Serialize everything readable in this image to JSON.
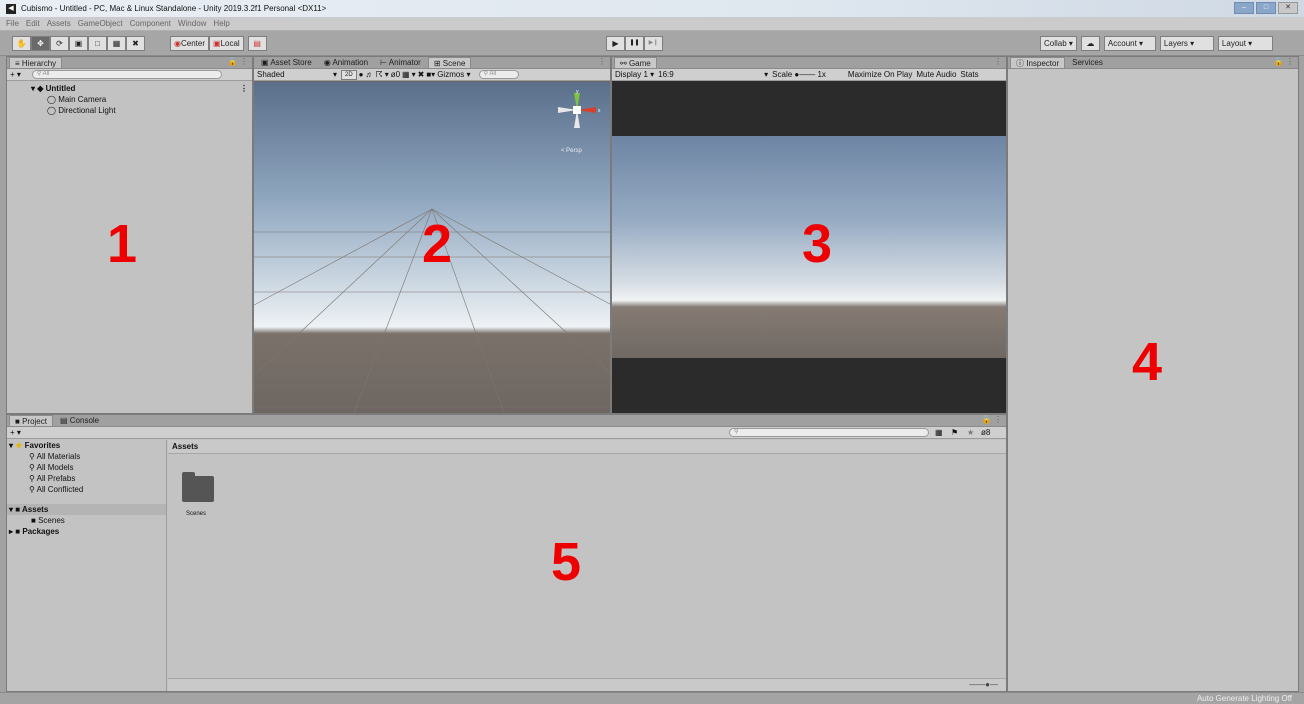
{
  "window": {
    "title": "Cubismo - Untitled - PC, Mac & Linux Standalone - Unity 2019.3.2f1 Personal <DX11>",
    "controls": [
      "–",
      "□",
      "✕"
    ]
  },
  "menu": [
    "File",
    "Edit",
    "Assets",
    "GameObject",
    "Component",
    "Window",
    "Help"
  ],
  "toolbar": {
    "tools": [
      "hand-icon",
      "move-icon",
      "rotate-icon",
      "scale-icon",
      "rect-icon",
      "transform-icon",
      "custom-tool-icon"
    ],
    "pivot_label": "Center",
    "space_label": "Local",
    "play_controls": [
      "▶",
      "❚❚",
      "▶❙"
    ],
    "collab_label": "Collab ▾",
    "account_label": "Account",
    "layers_label": "Layers",
    "layout_label": "Layout"
  },
  "hierarchy": {
    "tab": "Hierarchy",
    "add": "+ ▾",
    "search_placeholder": "All",
    "scene": "Untitled",
    "items": [
      "Main Camera",
      "Directional Light"
    ]
  },
  "scene_panel": {
    "tabs": [
      "Asset Store",
      "Animation",
      "Animator",
      "Scene"
    ],
    "shading": "Shaded",
    "toggle_2d": "2D",
    "fx_count": "0",
    "gizmos": "Gizmos",
    "search_placeholder": "All",
    "persp_label": "< Persp"
  },
  "game_panel": {
    "tab": "Game",
    "display": "Display 1",
    "aspect": "16:9",
    "scale_label": "Scale",
    "scale_value": "1x",
    "maximize": "Maximize On Play",
    "mute": "Mute Audio",
    "stats": "Stats"
  },
  "inspector": {
    "tabs": [
      "Inspector",
      "Services"
    ]
  },
  "project": {
    "tabs": [
      "Project",
      "Console"
    ],
    "add": "+ ▾",
    "favorites_label": "Favorites",
    "favorites": [
      "All Materials",
      "All Models",
      "All Prefabs",
      "All Conflicted"
    ],
    "assets_label": "Assets",
    "assets_children": [
      "Scenes"
    ],
    "packages_label": "Packages",
    "breadcrumb": "Assets",
    "folder_name": "Scenes",
    "hidden_count": "8"
  },
  "annotations": [
    "1",
    "2",
    "3",
    "4",
    "5"
  ],
  "status": {
    "text": "Auto Generate Lighting Off"
  },
  "colors": {
    "annotation": "#ee0000",
    "panel": "#c2c2c2",
    "toolbar": "#a6a6a6"
  }
}
